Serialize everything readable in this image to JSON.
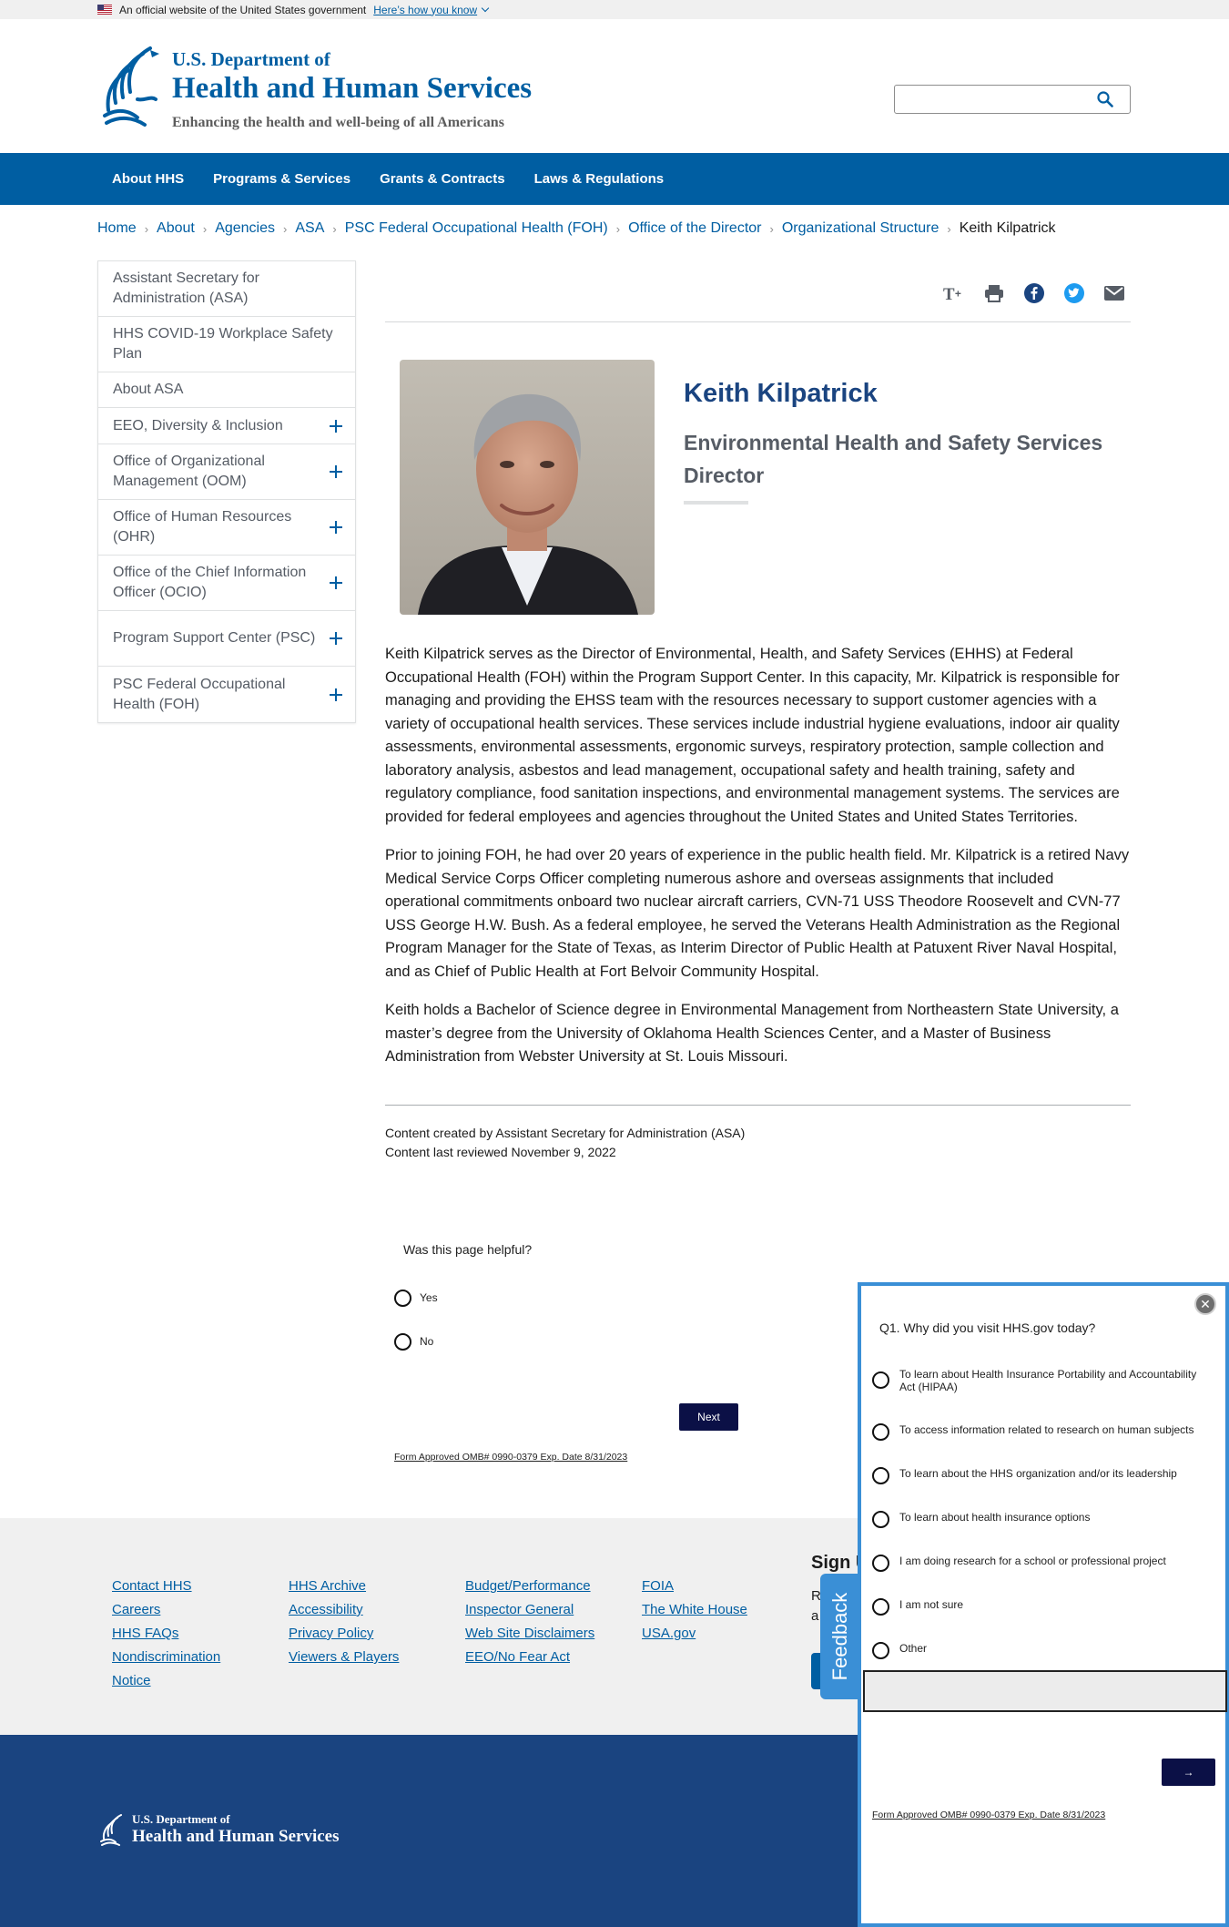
{
  "gov_banner": {
    "text": "An official website of the United States government",
    "link": "Here’s how you know"
  },
  "header": {
    "dept": "U.S. Department of",
    "name": "Health and Human Services",
    "tagline": "Enhancing the health and well-being of all Americans",
    "search_icon": "search-icon"
  },
  "nav": [
    "About HHS",
    "Programs & Services",
    "Grants & Contracts",
    "Laws & Regulations"
  ],
  "breadcrumb": [
    "Home",
    "About",
    "Agencies",
    "ASA",
    "PSC Federal Occupational Health (FOH)",
    "Office of the Director",
    "Organizational Structure"
  ],
  "breadcrumb_current": "Keith Kilpatrick",
  "sidebar": [
    {
      "label": "Assistant Secretary for Administration (ASA)",
      "expandable": false
    },
    {
      "label": "HHS COVID-19 Workplace Safety Plan",
      "expandable": false
    },
    {
      "label": "About ASA",
      "expandable": false
    },
    {
      "label": "EEO, Diversity & Inclusion",
      "expandable": true
    },
    {
      "label": "Office of Organizational Management (OOM)",
      "expandable": true
    },
    {
      "label": "Office of Human Resources (OHR)",
      "expandable": true
    },
    {
      "label": "Office of the Chief Information Officer (OCIO)",
      "expandable": true
    },
    {
      "label": "Program Support Center (PSC)",
      "expandable": true
    },
    {
      "label": "PSC Federal Occupational Health (FOH)",
      "expandable": true
    }
  ],
  "share_icons": [
    "text-size-icon",
    "print-icon",
    "facebook-icon",
    "twitter-icon",
    "email-icon"
  ],
  "bio": {
    "name": "Keith Kilpatrick",
    "title": "Environmental Health and Safety Services Director",
    "paragraphs": [
      "Keith Kilpatrick serves as the Director of Environmental, Health, and Safety Services (EHHS) at Federal Occupational Health (FOH) within the Program Support Center.  In this capacity, Mr. Kilpatrick is responsible for managing and providing the EHSS team with the resources necessary to support customer agencies with a variety of occupational health services. These services include industrial hygiene evaluations, indoor air quality assessments, environmental assessments, ergonomic surveys, respiratory protection, sample collection and laboratory analysis, asbestos and lead management, occupational safety and health training, safety and regulatory compliance, food sanitation inspections, and environmental management systems. The services are provided for federal employees and agencies throughout the United States and United States Territories.",
      "Prior to joining FOH, he had over 20 years of experience in the public health field. Mr. Kilpatrick is a retired Navy Medical Service Corps Officer completing numerous ashore and overseas assignments that included operational commitments onboard two nuclear aircraft carriers, CVN-71 USS Theodore Roosevelt and CVN-77 USS George H.W. Bush. As a federal employee, he served the Veterans Health Administration as the Regional Program Manager for the State of Texas, as Interim Director of Public Health at Patuxent River Naval Hospital, and as Chief of Public Health at Fort Belvoir Community Hospital.",
      "Keith holds a Bachelor of Science degree in Environmental Management from Northeastern State University, a master’s degree from the University of Oklahoma Health Sciences Center, and a Master of Business Administration from Webster University at St. Louis Missouri."
    ]
  },
  "meta": {
    "created": "Content created by Assistant Secretary for Administration (ASA)",
    "reviewed": "Content last reviewed November 9, 2022"
  },
  "helpful": {
    "question": "Was this page helpful?",
    "options": [
      "Yes",
      "No"
    ],
    "next": "Next",
    "omb": "Form Approved OMB# 0990-0379 Exp. Date 8/31/2023"
  },
  "footer": {
    "col1": [
      "Contact HHS",
      "Careers",
      "HHS FAQs",
      "Nondiscrimination Notice"
    ],
    "col2": [
      "HHS Archive",
      "Accessibility",
      "Privacy Policy",
      "Viewers & Players"
    ],
    "col3": [
      "Budget/Performance",
      "Inspector General",
      "Web Site Disclaimers",
      "EEO/No Fear Act"
    ],
    "col4": [
      "FOIA",
      "The White House",
      "USA.gov"
    ],
    "signup_title": "Sign U",
    "signup_text_1": "R",
    "signup_text_2": "a",
    "dept": "U.S. Department of",
    "name": "Health and Human Services"
  },
  "feedback_tab": "Feedback",
  "survey": {
    "question": "Q1. Why did you visit HHS.gov today?",
    "options": [
      "To learn about Health Insurance Portability and Accountability Act (HIPAA)",
      "To access information related to research on human subjects",
      "To learn about the HHS organization and/or its leadership",
      "To learn about health insurance options",
      "I am doing research for a school or professional project",
      "I am not sure",
      "Other"
    ],
    "next": "→",
    "omb": "Form Approved OMB# 0990-0379 Exp. Date 8/31/2023"
  }
}
